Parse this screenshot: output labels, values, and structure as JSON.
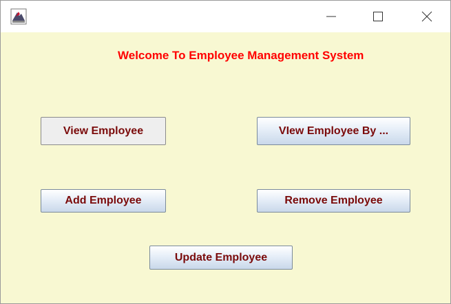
{
  "window": {
    "title": "",
    "icon": "java-app-icon",
    "controls": {
      "minimize_icon": "minimize-icon",
      "maximize_icon": "maximize-icon",
      "close_icon": "close-icon"
    }
  },
  "main": {
    "welcome_text": "Welcome To Employee Management System",
    "buttons": {
      "view_employee": "View Employee",
      "view_employee_by": "VIew Employee By ...",
      "add_employee": "Add Employee",
      "remove_employee": "Remove Employee",
      "update_employee": "Update Employee"
    }
  },
  "colors": {
    "background": "#f8f8d2",
    "welcome_text": "#ff0000",
    "button_text": "#7a0a0a"
  }
}
